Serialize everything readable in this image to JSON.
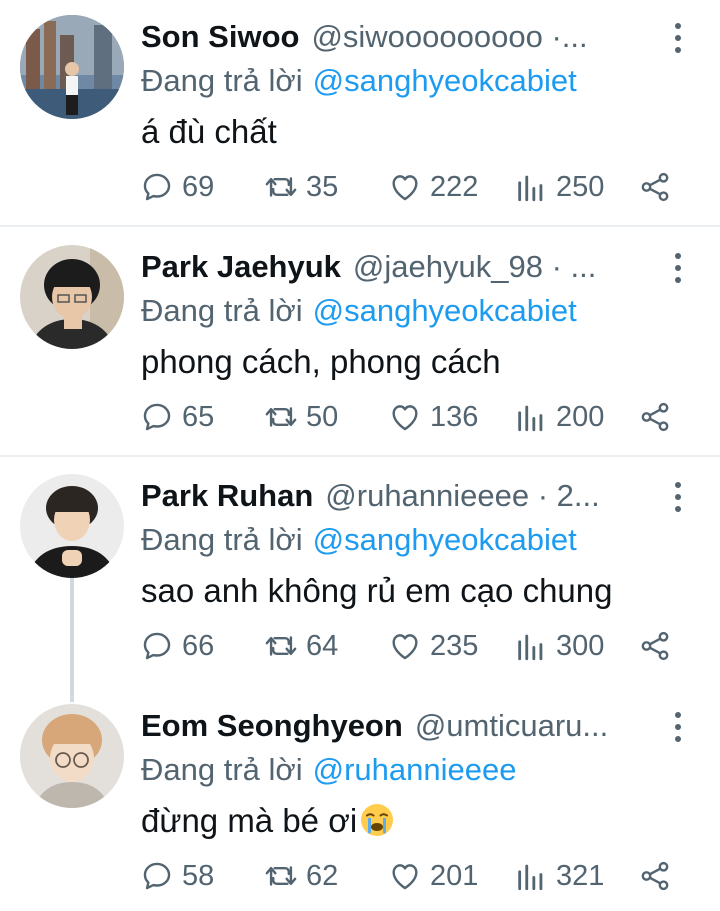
{
  "tweets": [
    {
      "name": "Son Siwoo",
      "handle": "@siwooooooooo ·...",
      "replying_label": "Đang trả lời",
      "replying_to": "@sanghyeokcabiet",
      "text": "á đù chất",
      "replies": "69",
      "retweets": "35",
      "likes": "222",
      "views": "250"
    },
    {
      "name": "Park Jaehyuk",
      "handle": "@jaehyuk_98 · ...",
      "replying_label": "Đang trả lời",
      "replying_to": "@sanghyeokcabiet",
      "text": "phong cách, phong cách",
      "replies": "65",
      "retweets": "50",
      "likes": "136",
      "views": "200"
    },
    {
      "name": "Park Ruhan",
      "handle": "@ruhannieeee · 2...",
      "replying_label": "Đang trả lời",
      "replying_to": "@sanghyeokcabiet",
      "text": "sao anh không rủ em cạo chung",
      "replies": "66",
      "retweets": "64",
      "likes": "235",
      "views": "300"
    },
    {
      "name": "Eom Seonghyeon",
      "handle": "@umticuaru...",
      "replying_label": "Đang trả lời",
      "replying_to": "@ruhannieeee",
      "text": "đừng mà bé ơi",
      "replies": "58",
      "retweets": "62",
      "likes": "201",
      "views": "321"
    }
  ],
  "colors": {
    "text": "#0f1419",
    "secondary": "#536471",
    "mention": "#1d9bf0",
    "divider": "#eceff1"
  },
  "icons": [
    "reply-icon",
    "retweet-icon",
    "like-icon",
    "views-icon",
    "share-icon",
    "more-icon",
    "crying-face-emoji"
  ]
}
